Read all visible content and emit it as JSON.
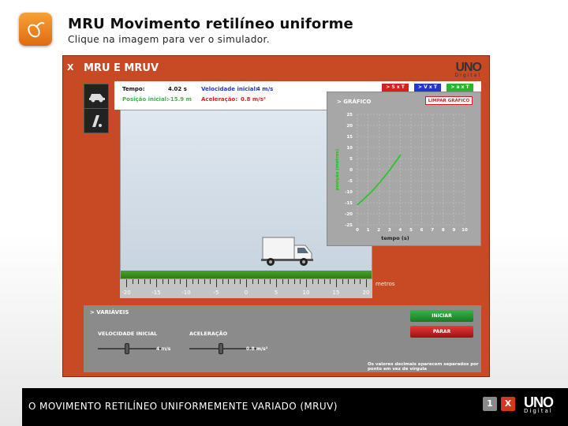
{
  "header": {
    "title": "MRU Movimento retilíneo uniforme",
    "subtitle": "Clique na imagem para ver o simulador."
  },
  "simulator": {
    "close_label": "X",
    "title": "MRU E MRUV",
    "logo_main": "UNO",
    "logo_sub": "Digital",
    "info": {
      "time_label": "Tempo:",
      "time_value": "4.02 s",
      "position_label": "Posição inicial:",
      "position_value": "-15.9 m",
      "velocity_label": "Velocidade inicial:",
      "velocity_value": "4 m/s",
      "accel_label": "Aceleração:",
      "accel_value": "0.8 m/s²"
    },
    "graph_buttons": [
      "> S x T",
      "> V x T",
      "> a x T"
    ],
    "graph": {
      "title": "> GRÁFICO",
      "clear_label": "LIMPAR GRÁFICO",
      "ylabel": "posição (metros)",
      "xlabel": "tempo (s)",
      "y_ticks": [
        "25",
        "20",
        "15",
        "10",
        "5",
        "0",
        "-5",
        "-10",
        "-15",
        "-20",
        "-25"
      ],
      "x_ticks": [
        "0",
        "1",
        "2",
        "3",
        "4",
        "5",
        "6",
        "7",
        "8",
        "9",
        "10"
      ]
    },
    "ruler": {
      "ticks": [
        "-20",
        "-15",
        "-10",
        "-5",
        "0",
        "5",
        "10",
        "15",
        "20"
      ],
      "unit": "metros"
    },
    "variables": {
      "title": "> VARIÁVEIS",
      "velocity_label": "VELOCIDADE INICIAL",
      "velocity_value": "4 m/s",
      "accel_label": "ACELERAÇÃO",
      "accel_value": "0.8 m/s²",
      "start_label": "INICIAR",
      "stop_label": "PARAR",
      "note": "Os valores decimais aparecem separados por ponto em vez de vírgula"
    }
  },
  "chart_data": {
    "type": "line",
    "x": [
      0,
      0.5,
      1,
      1.5,
      2,
      2.5,
      3,
      3.5,
      4.02
    ],
    "y": [
      -15.9,
      -13.8,
      -11.5,
      -9.1,
      -6.3,
      -3.4,
      -0.3,
      3.1,
      6.6
    ],
    "xlim": [
      0,
      10
    ],
    "ylim": [
      -25,
      25
    ],
    "color": "#1ec81e"
  },
  "footer": {
    "text": "O MOVIMENTO RETILÍNEO UNIFORMEMENTE VARIADO (MRUV)",
    "info_icon": "1",
    "close_icon": "X",
    "logo_main": "UNO",
    "logo_sub": "Digital"
  }
}
